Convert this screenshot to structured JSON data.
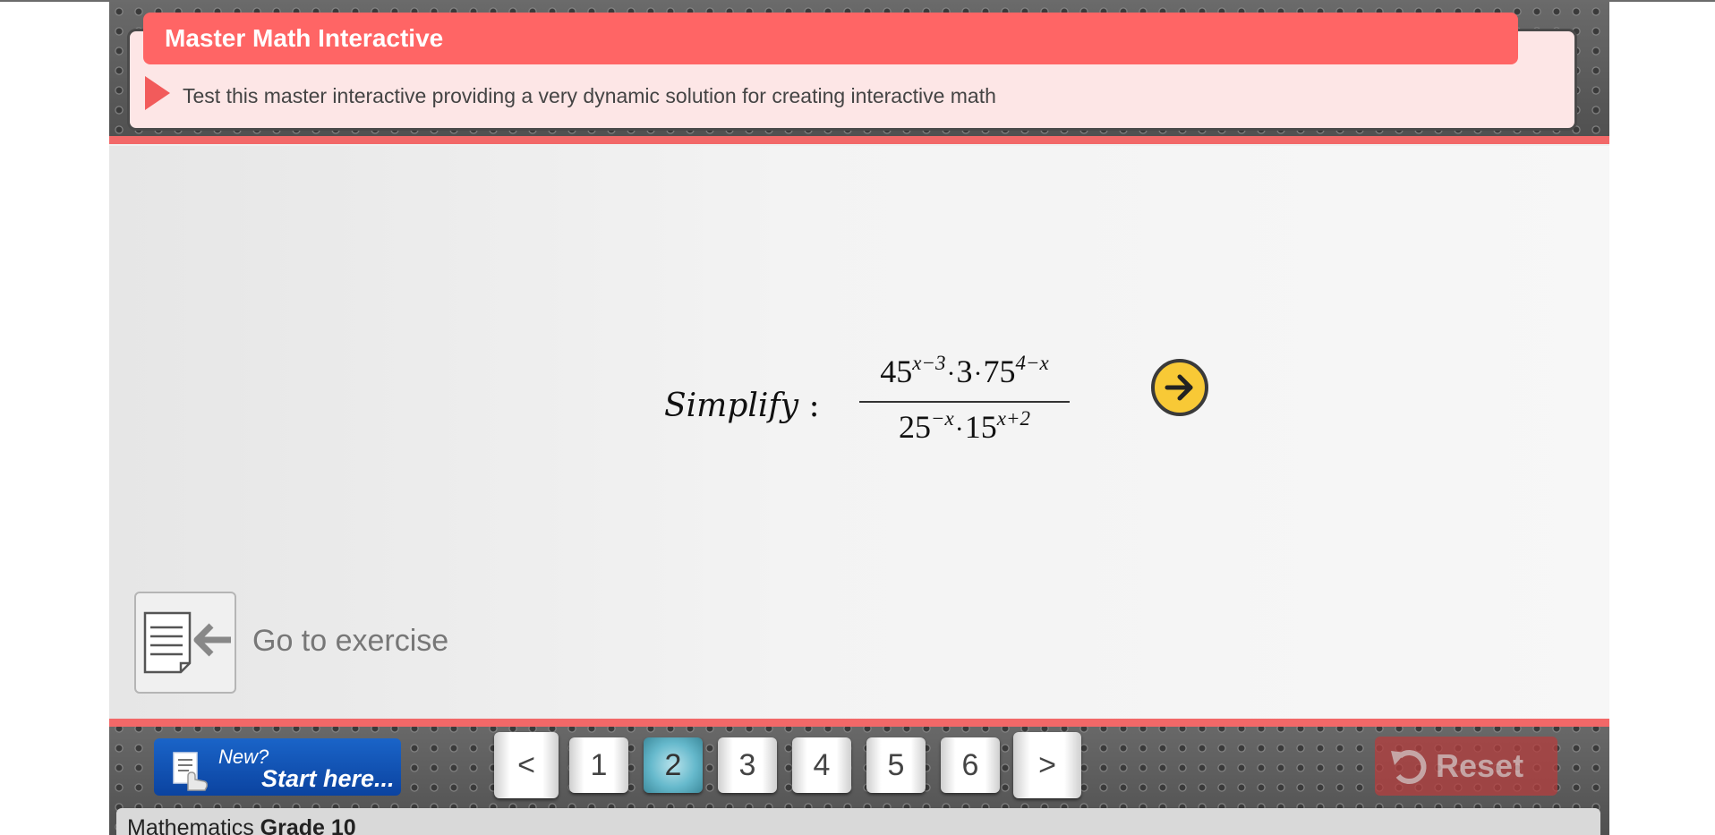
{
  "header": {
    "title": "Master Math Interactive",
    "subtitle": "Test this master interactive providing a very dynamic solution for creating interactive math"
  },
  "problem": {
    "label": "Simplify",
    "colon": ":",
    "numerator": {
      "base1": "45",
      "exp1": "x−3",
      "dot1": "·",
      "factor": "3",
      "dot2": "·",
      "base2": "75",
      "exp2": "4−x"
    },
    "denominator": {
      "base1": "25",
      "exp1": "−x",
      "dot": "·",
      "base2": "15",
      "exp2": "x+2"
    }
  },
  "goto_exercise": {
    "label": "Go to exercise"
  },
  "footer": {
    "start": {
      "new_label": "New?",
      "label": "Start here..."
    },
    "pager": {
      "prev": "<",
      "next": ">",
      "pages": [
        "1",
        "2",
        "3",
        "4",
        "5",
        "6"
      ],
      "current": "2"
    },
    "reset_label": "Reset",
    "grade": {
      "subject": "Mathematics",
      "grade": "Grade 10"
    }
  },
  "colors": {
    "accent": "#ff6565",
    "header_panel": "#fde6e6",
    "next_button": "#f8c936",
    "start_button": "#0b43a0",
    "active_page": "#66b9cc",
    "reset_button": "#b53d3d"
  },
  "icons": {
    "header": "play-triangle-icon",
    "next": "arrow-right-circle-icon",
    "goto": "document-arrow-icon",
    "start": "touch-document-icon",
    "reset": "undo-arrow-icon"
  }
}
